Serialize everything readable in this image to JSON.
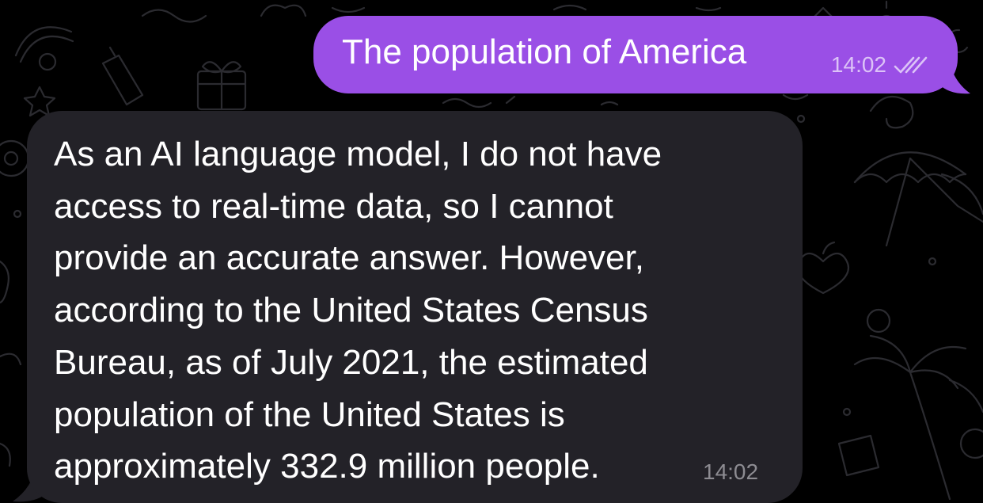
{
  "outgoing_message": {
    "text": "The population of America",
    "time": "14:02",
    "status_icon": "double-check-icon",
    "bubble_color": "#9a4fe6"
  },
  "incoming_message": {
    "lines": [
      "As an AI language model, I do not have",
      "access to real-time data, so I cannot",
      "provide an accurate answer. However,",
      "according to the United States Census",
      "Bureau, as of July 2021, the estimated",
      "population of the United States is",
      "approximately 332.9 million people."
    ],
    "time": "14:02",
    "bubble_color": "#232228"
  },
  "colors": {
    "background": "#000000",
    "doodle": "#2a2a2e"
  }
}
